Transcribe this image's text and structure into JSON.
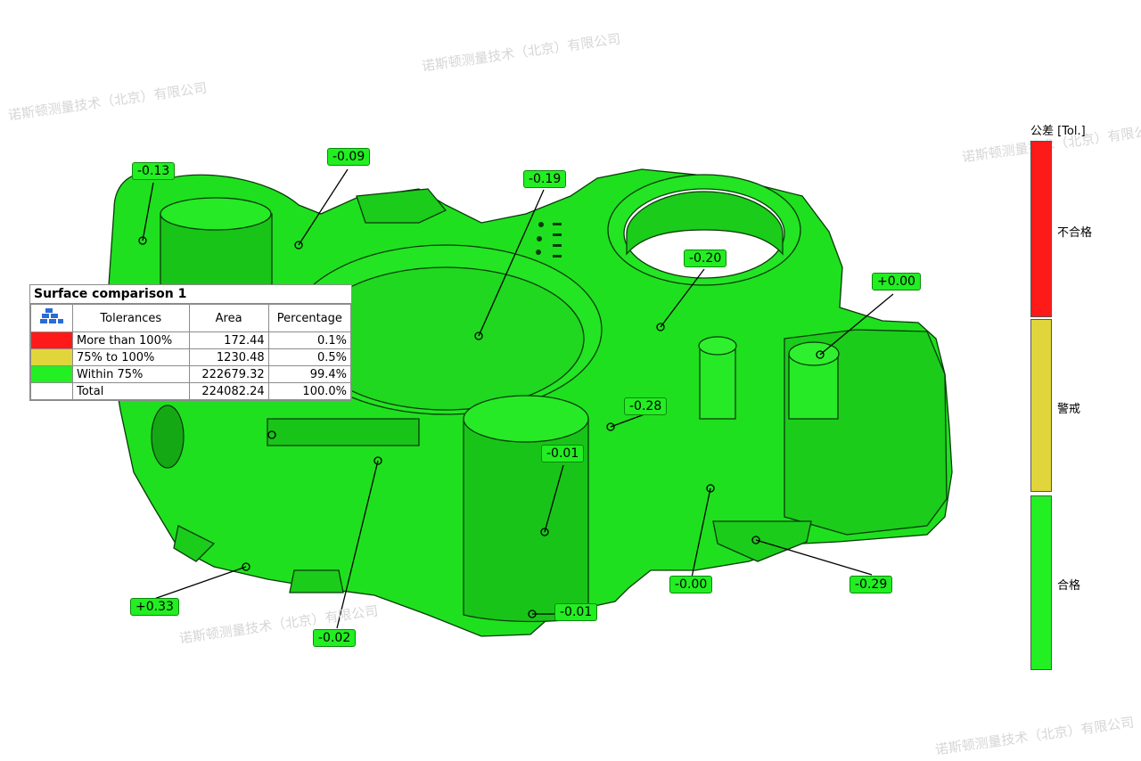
{
  "watermark_text": "诺斯顿测量技术（北京）有限公司",
  "table": {
    "title": "Surface comparison 1",
    "icon": "surface-comparison-icon",
    "headers": [
      "Tolerances",
      "Area",
      "Percentage"
    ],
    "rows": [
      {
        "color": "#ff1a1a",
        "label": "More than 100%",
        "area": "172.44",
        "percentage": "0.1%"
      },
      {
        "color": "#e0d63c",
        "label": "75% to 100%",
        "area": "1230.48",
        "percentage": "0.5%"
      },
      {
        "color": "#22f022",
        "label": "Within 75%",
        "area": "222679.32",
        "percentage": "99.4%"
      },
      {
        "color": "#ffffff",
        "label": "Total",
        "area": "224082.24",
        "percentage": "100.0%"
      }
    ]
  },
  "legend": {
    "title": "公差 [Tol.]",
    "bands": [
      {
        "label": "不合格",
        "color": "#ff1a1a"
      },
      {
        "label": "警戒",
        "color": "#e0d63c"
      },
      {
        "label": "合格",
        "color": "#22f022"
      }
    ]
  },
  "callouts": [
    "-0.13",
    "-0.09",
    "-0.19",
    "-0.20",
    "+0.00",
    "-0.28",
    "-0.01",
    "-0.00",
    "-0.29",
    "-0.01",
    "+0.33",
    "-0.02"
  ],
  "colors": {
    "part": "#1fe01f",
    "part_dark": "#17b417",
    "edge": "#0a3a0a",
    "callout_bg": "#22ee22"
  }
}
